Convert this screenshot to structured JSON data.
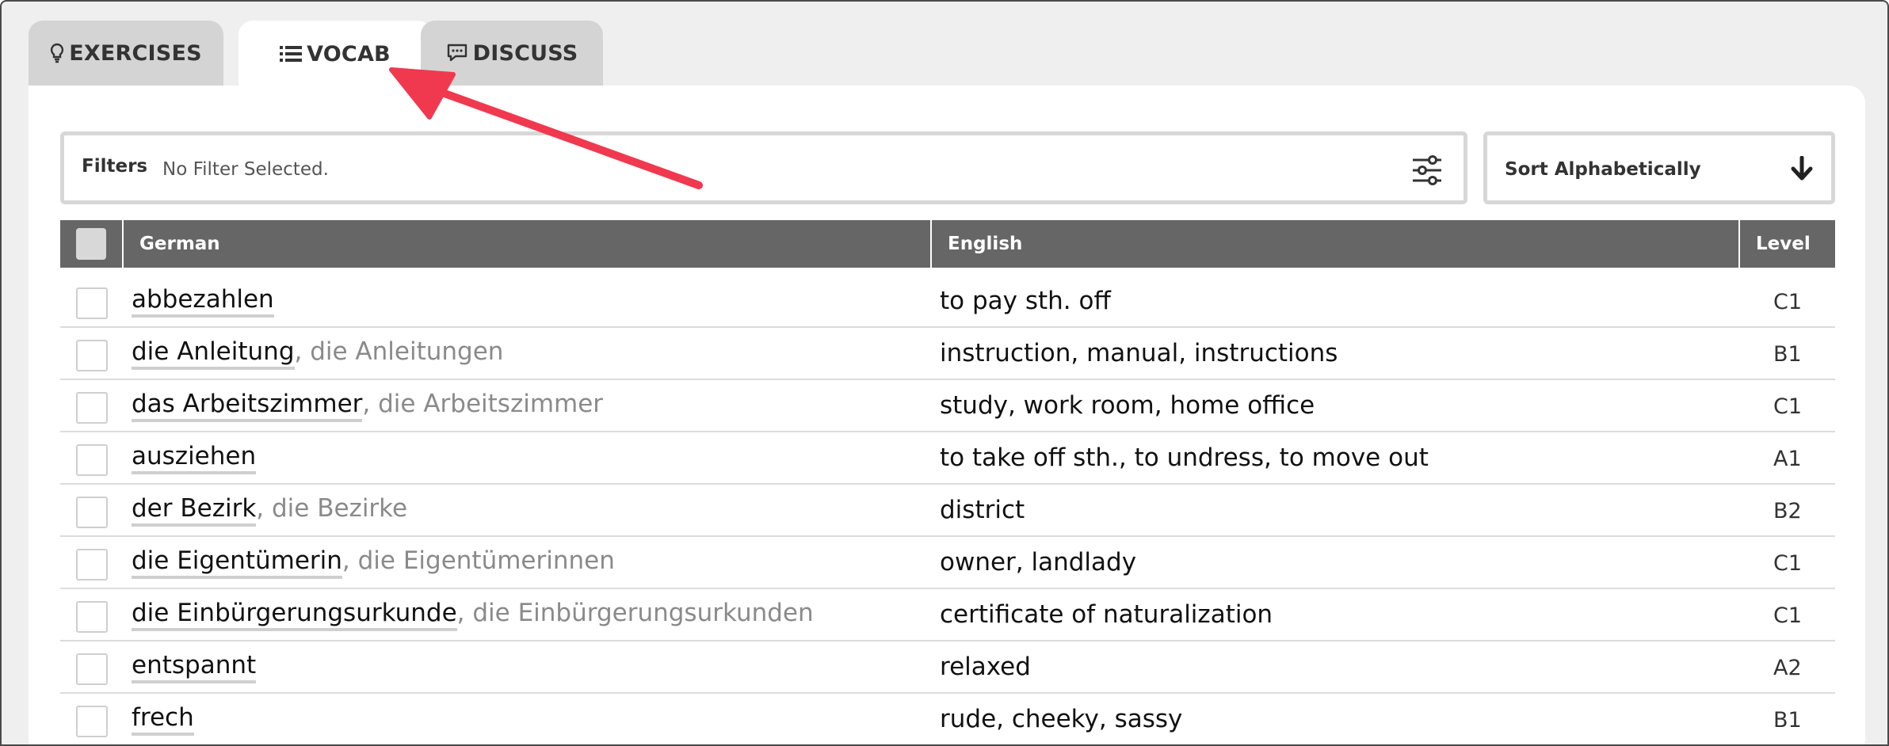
{
  "tabs": [
    {
      "label": "EXERCISES",
      "icon": "lightbulb-icon"
    },
    {
      "label": "VOCAB",
      "icon": "list-icon",
      "active": true
    },
    {
      "label": "DISCUSS",
      "icon": "speech-bubble-icon"
    }
  ],
  "filters": {
    "label": "Filters",
    "value": "No Filter Selected."
  },
  "sort": {
    "label": "Sort Alphabetically"
  },
  "table": {
    "columns": {
      "german": "German",
      "english": "English",
      "level": "Level"
    },
    "rows": [
      {
        "word": "abbezahlen",
        "plural": "",
        "english": "to pay sth. off",
        "level": "C1"
      },
      {
        "word": "die Anleitung",
        "plural": ", die Anleitungen",
        "english": "instruction, manual, instructions",
        "level": "B1"
      },
      {
        "word": "das Arbeitszimmer",
        "plural": ", die Arbeitszimmer",
        "english": "study, work room, home office",
        "level": "C1"
      },
      {
        "word": "ausziehen",
        "plural": "",
        "english": "to take off sth., to undress, to move out",
        "level": "A1"
      },
      {
        "word": "der Bezirk",
        "plural": ", die Bezirke",
        "english": "district",
        "level": "B2"
      },
      {
        "word": "die Eigentümerin",
        "plural": ", die Eigentümerinnen",
        "english": "owner, landlady",
        "level": "C1"
      },
      {
        "word": "die Einbürgerungsurkunde",
        "plural": ", die Einbürgerungsurkunden",
        "english": "certificate of naturalization",
        "level": "C1"
      },
      {
        "word": "entspannt",
        "plural": "",
        "english": "relaxed",
        "level": "A2"
      },
      {
        "word": "frech",
        "plural": "",
        "english": "rude, cheeky, sassy",
        "level": "B1"
      }
    ]
  },
  "colors": {
    "accent_arrow": "#f0394f",
    "header_bg": "#666666",
    "tab_bg": "#d4d4d4"
  }
}
